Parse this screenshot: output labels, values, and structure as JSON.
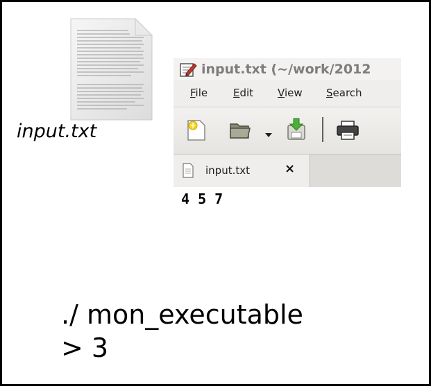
{
  "desktop": {
    "file_icon": "text-document-icon",
    "file_label": "input.txt"
  },
  "editor": {
    "title": "input.txt (~/work/2012",
    "app_icon": "text-editor-icon",
    "menu": [
      {
        "label": "File",
        "mnemonic": "F",
        "rest": "ile"
      },
      {
        "label": "Edit",
        "mnemonic": "E",
        "rest": "dit"
      },
      {
        "label": "View",
        "mnemonic": "V",
        "rest": "iew"
      },
      {
        "label": "Search",
        "mnemonic": "S",
        "rest": "earch"
      }
    ],
    "toolbar_icons": [
      "new-document-icon",
      "open-folder-icon",
      "dropdown-arrow-icon",
      "save-icon",
      "print-icon"
    ],
    "tab": {
      "label": "input.txt",
      "close": "×",
      "icon": "document-icon"
    },
    "content": "4 5 7"
  },
  "command": {
    "line1": "./ mon_executable",
    "line2": "> 3"
  }
}
